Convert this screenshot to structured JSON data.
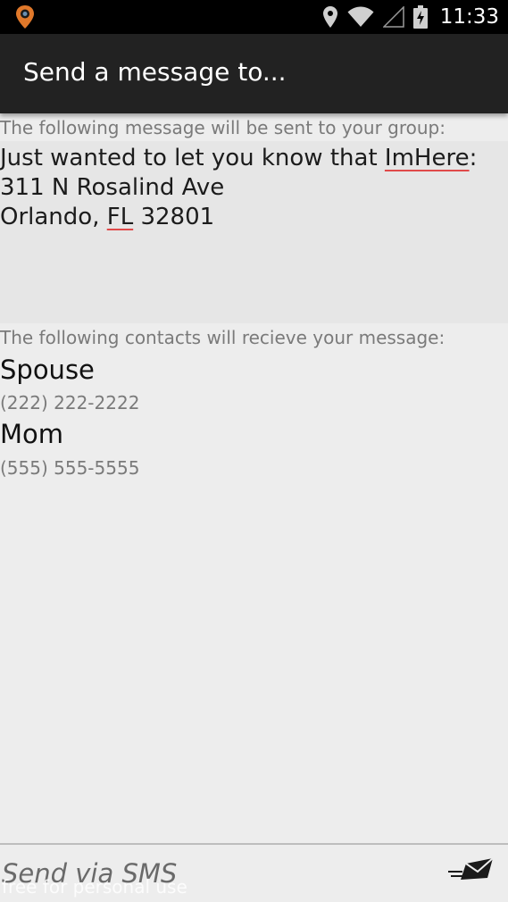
{
  "status_bar": {
    "time": "11:33",
    "icons": [
      "location-pin-icon",
      "wifi-icon",
      "cell-signal-icon",
      "battery-charging-icon"
    ]
  },
  "action_bar": {
    "title": "Send a message to..."
  },
  "message": {
    "label": "The following message will be sent to your group:",
    "line1_prefix": "Just wanted to let you know that ",
    "line1_flagged": "ImHere",
    "line1_suffix": ":",
    "line2": "311 N Rosalind Ave",
    "line3_prefix": "Orlando, ",
    "line3_flagged": "FL",
    "line3_suffix": " 32801"
  },
  "contacts": {
    "label": "The following contacts will recieve your message:",
    "items": [
      {
        "name": "Spouse",
        "phone": "(222) 222-2222"
      },
      {
        "name": "Mom",
        "phone": "(555) 555-5555"
      }
    ]
  },
  "compose": {
    "placeholder": "Send via SMS",
    "send_icon": "send-envelope-icon",
    "watermark": "free for personal use"
  },
  "colors": {
    "status_bar": "#000000",
    "action_bar": "#222222",
    "background": "#ededed",
    "message_box": "#e6e6e6",
    "spellcheck_underline": "#e04a4a",
    "app_icon_accent": "#e0782a"
  }
}
